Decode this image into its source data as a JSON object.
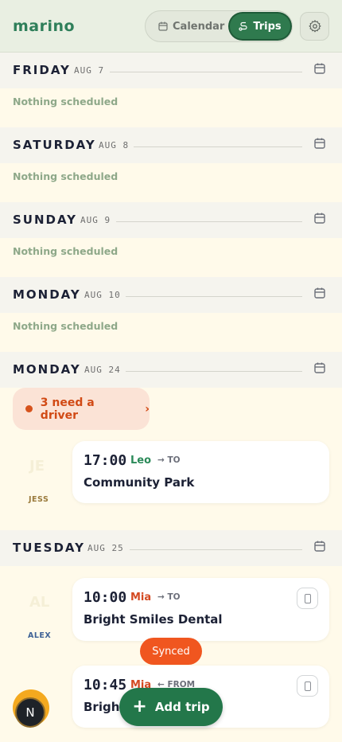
{
  "header": {
    "logo": "marino",
    "tabs": {
      "calendar": "Calendar",
      "trips": "Trips"
    },
    "active_tab": "trips"
  },
  "days": [
    {
      "name": "FRIDAY",
      "date": "AUG 7",
      "empty": "Nothing scheduled"
    },
    {
      "name": "SATURDAY",
      "date": "AUG 8",
      "empty": "Nothing scheduled"
    },
    {
      "name": "SUNDAY",
      "date": "AUG 9",
      "empty": "Nothing scheduled"
    },
    {
      "name": "MONDAY",
      "date": "AUG 10",
      "empty": "Nothing scheduled"
    },
    {
      "name": "MONDAY",
      "date": "AUG 24"
    },
    {
      "name": "TUESDAY",
      "date": "AUG 25"
    }
  ],
  "need_driver": {
    "text": "3 need a driver",
    "chevron": "›"
  },
  "trips": [
    {
      "time": "17:00",
      "kid": "Leo",
      "kid_color": "#2b8a59",
      "direction": "→ TO",
      "destination": "Community Park",
      "driver": "JESS",
      "driver_color": "#9a7a3c",
      "avatar_initials": "JE"
    },
    {
      "time": "10:00",
      "kid": "Mia",
      "kid_color": "#d44a22",
      "direction": "→ TO",
      "destination": "Bright Smiles Dental",
      "driver": "ALEX",
      "driver_color": "#3e6296",
      "avatar_initials": "AL"
    },
    {
      "time": "10:45",
      "kid": "Mia",
      "kid_color": "#d44a22",
      "direction": "← FROM",
      "destination": "Bright Smiles Dental"
    }
  ],
  "toast": "Synced",
  "user_avatar": "N",
  "add_trip": {
    "label": "Add trip",
    "icon": "+"
  }
}
